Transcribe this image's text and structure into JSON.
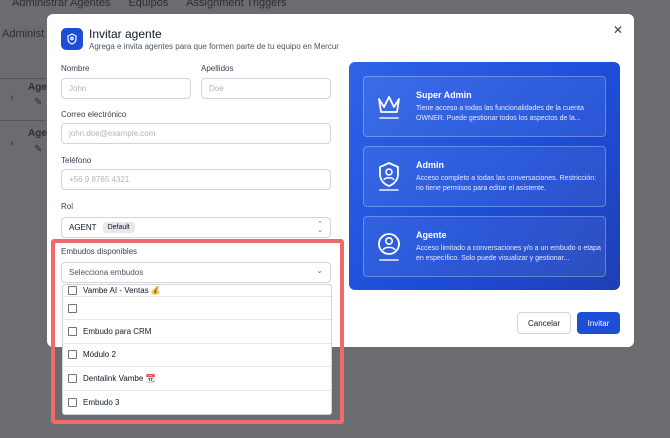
{
  "background": {
    "tabs": [
      "Administrar Agentes",
      "Equipos",
      "Assignment Triggers"
    ],
    "title": "Administ",
    "rows": [
      {
        "label": "Agen"
      },
      {
        "label": "Agen"
      }
    ]
  },
  "modal": {
    "title": "Invitar agente",
    "subtitle": "Agrega e invita agentes para que formen parte de tu equipo en Mercur",
    "close_icon": "close-icon",
    "fields": {
      "nombre": {
        "label": "Nombre",
        "placeholder": "John"
      },
      "apellidos": {
        "label": "Apellidos",
        "placeholder": "Doe"
      },
      "correo": {
        "label": "Correo electrónico",
        "placeholder": "john.doe@example.com"
      },
      "telefono": {
        "label": "Teléfono",
        "placeholder": "+56 9 8765 4321"
      },
      "rol": {
        "label": "Rol",
        "value": "AGENT",
        "badge": "Default"
      },
      "embudos": {
        "label": "Embudos disponibles",
        "placeholder": "Selecciona embudos"
      }
    },
    "dropdown_items": [
      "Vambe AI - Ventas 💰",
      "",
      "Embudo para CRM",
      "Módulo 2",
      "Dentalink Vambe 📆",
      "Embudo 3"
    ],
    "roles": [
      {
        "title": "Super Admin",
        "description": "Tiene acceso a todas las funcionalidades de la cuenta OWNER. Puede gestionar todos los aspectos de la...",
        "icon": "crown-icon"
      },
      {
        "title": "Admin",
        "description": "Acceso completo a todas las conversaciones. Restricción: no tiene permisos para editar el asistente.",
        "icon": "shield-user-icon"
      },
      {
        "title": "Agente",
        "description": "Acceso limitado a conversaciones y/o a un embudo o etapa en específico. Solo puede visualizar y gestionar...",
        "icon": "user-circle-icon"
      }
    ],
    "buttons": {
      "cancel": "Cancelar",
      "invite": "Invitar"
    }
  },
  "colors": {
    "primary": "#1d4ed8",
    "highlight": "#ef6b6b"
  }
}
